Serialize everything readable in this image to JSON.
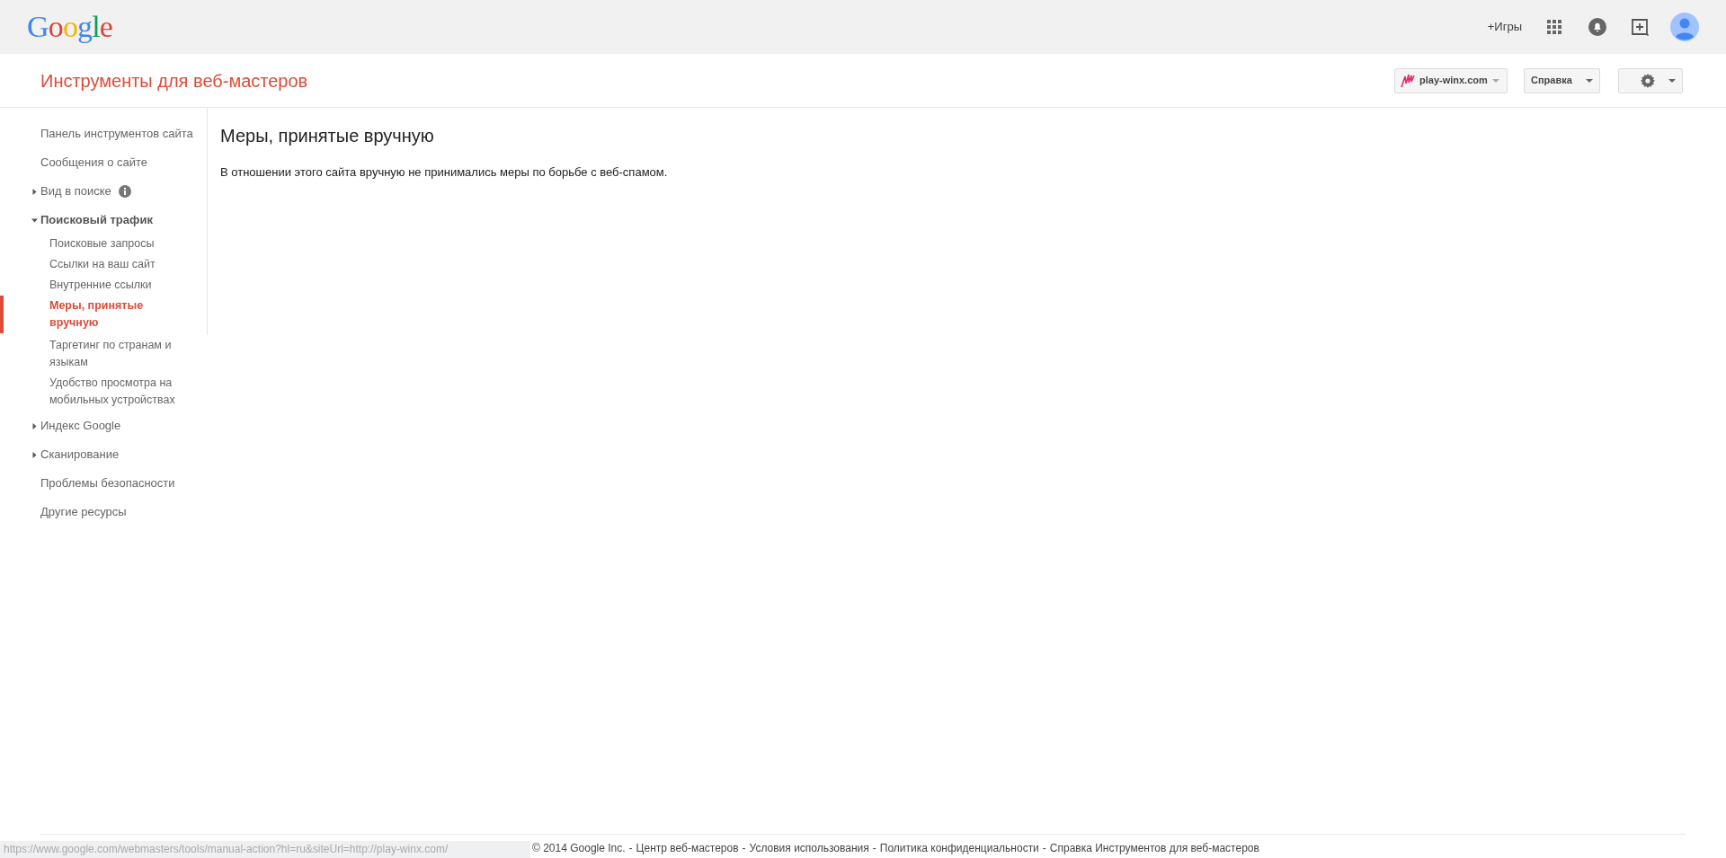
{
  "top_bar": {
    "logo": "Google",
    "plus_link": "+Игры"
  },
  "header": {
    "title": "Инструменты для веб-мастеров",
    "site_button": "play-winx.com",
    "help_button": "Справка"
  },
  "sidebar": {
    "items": [
      {
        "kind": "link",
        "label": "Панель инструментов сайта",
        "selected": false
      },
      {
        "kind": "link",
        "label": "Сообщения о сайте",
        "selected": false
      },
      {
        "kind": "group",
        "label": "Вид в поиске",
        "expanded": false,
        "info": true,
        "selected": false
      },
      {
        "kind": "group",
        "label": "Поисковый трафик",
        "expanded": true,
        "info": false,
        "selected": false,
        "children": [
          {
            "label": "Поисковые запросы",
            "selected": false
          },
          {
            "label": "Ссылки на ваш сайт",
            "selected": false
          },
          {
            "label": "Внутренние ссылки",
            "selected": false
          },
          {
            "label": "Меры, принятые вручную",
            "selected": true
          },
          {
            "label": "Таргетинг по странам и языкам",
            "selected": false
          },
          {
            "label": "Удобство просмотра на мобильных устройствах",
            "selected": false
          }
        ]
      },
      {
        "kind": "group",
        "label": "Индекс Google",
        "expanded": false,
        "info": false,
        "selected": false
      },
      {
        "kind": "group",
        "label": "Сканирование",
        "expanded": false,
        "info": false,
        "selected": false
      },
      {
        "kind": "link",
        "label": "Проблемы безопасности",
        "selected": false
      },
      {
        "kind": "link",
        "label": "Другие ресурсы",
        "selected": false
      }
    ]
  },
  "content": {
    "heading": "Меры, принятые вручную",
    "message": "В отношении этого сайта вручную не принимались меры по борьбе с веб-спамом."
  },
  "footer": {
    "copyright": "© 2014 Google Inc.",
    "separator": "-",
    "links": [
      "Центр веб-мастеров",
      "Условия использования",
      "Политика конфиденциальности",
      "Справка Инструментов для веб-мастеров"
    ]
  },
  "status_bar": {
    "url": "https://www.google.com/webmasters/tools/manual-action?hl=ru&siteUrl=http://play-winx.com/"
  }
}
